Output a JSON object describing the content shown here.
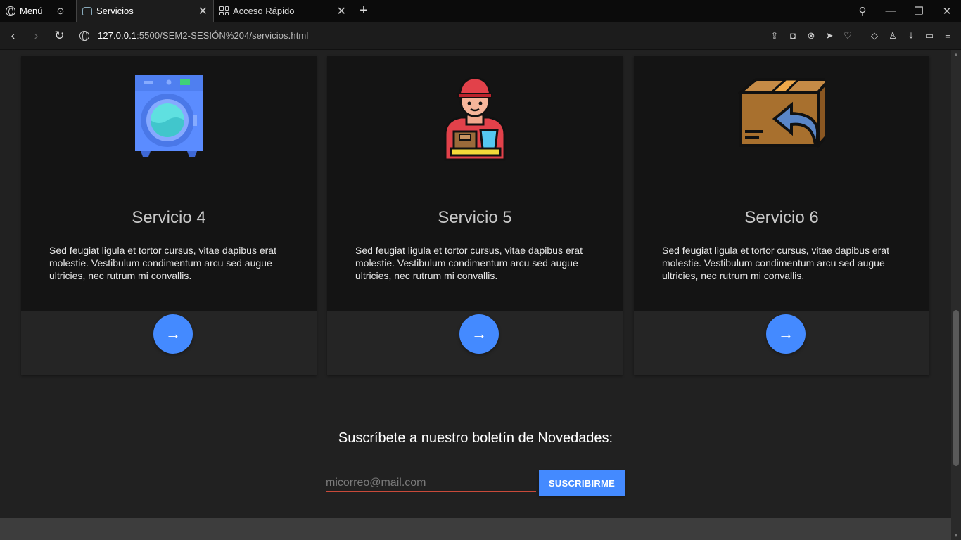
{
  "browser": {
    "menu_label": "Menú",
    "tabs": [
      {
        "label": "Servicios",
        "active": true,
        "icon": "cloud-favicon-icon"
      },
      {
        "label": "Acceso Rápido",
        "active": false,
        "icon": "grid-favicon-icon"
      }
    ],
    "new_tab_glyph": "+",
    "url_host": "127.0.0.1",
    "url_rest": ":5500/SEM2-SESIÓN%204/servicios.html"
  },
  "services": [
    {
      "title": "Servicio 4",
      "text": "Sed feugiat ligula et tortor cursus, vitae dapibus erat molestie. Vestibulum condimentum arcu sed augue ultricies, nec rutrum mi convallis.",
      "icon": "washing-machine-icon"
    },
    {
      "title": "Servicio 5",
      "text": "Sed feugiat ligula et tortor cursus, vitae dapibus erat molestie. Vestibulum condimentum arcu sed augue ultricies, nec rutrum mi convallis.",
      "icon": "delivery-person-icon"
    },
    {
      "title": "Servicio 6",
      "text": "Sed feugiat ligula et tortor cursus, vitae dapibus erat molestie. Vestibulum condimentum arcu sed augue ultricies, nec rutrum mi convallis.",
      "icon": "return-box-icon"
    }
  ],
  "arrow_glyph": "→",
  "newsletter": {
    "title": "Suscríbete a nuestro boletín de Novedades:",
    "placeholder": "micorreo@mail.com",
    "button_label": "SUSCRIBIRME"
  },
  "colors": {
    "accent": "#448aff",
    "card_top": "#141414",
    "page_bg": "#212121"
  }
}
